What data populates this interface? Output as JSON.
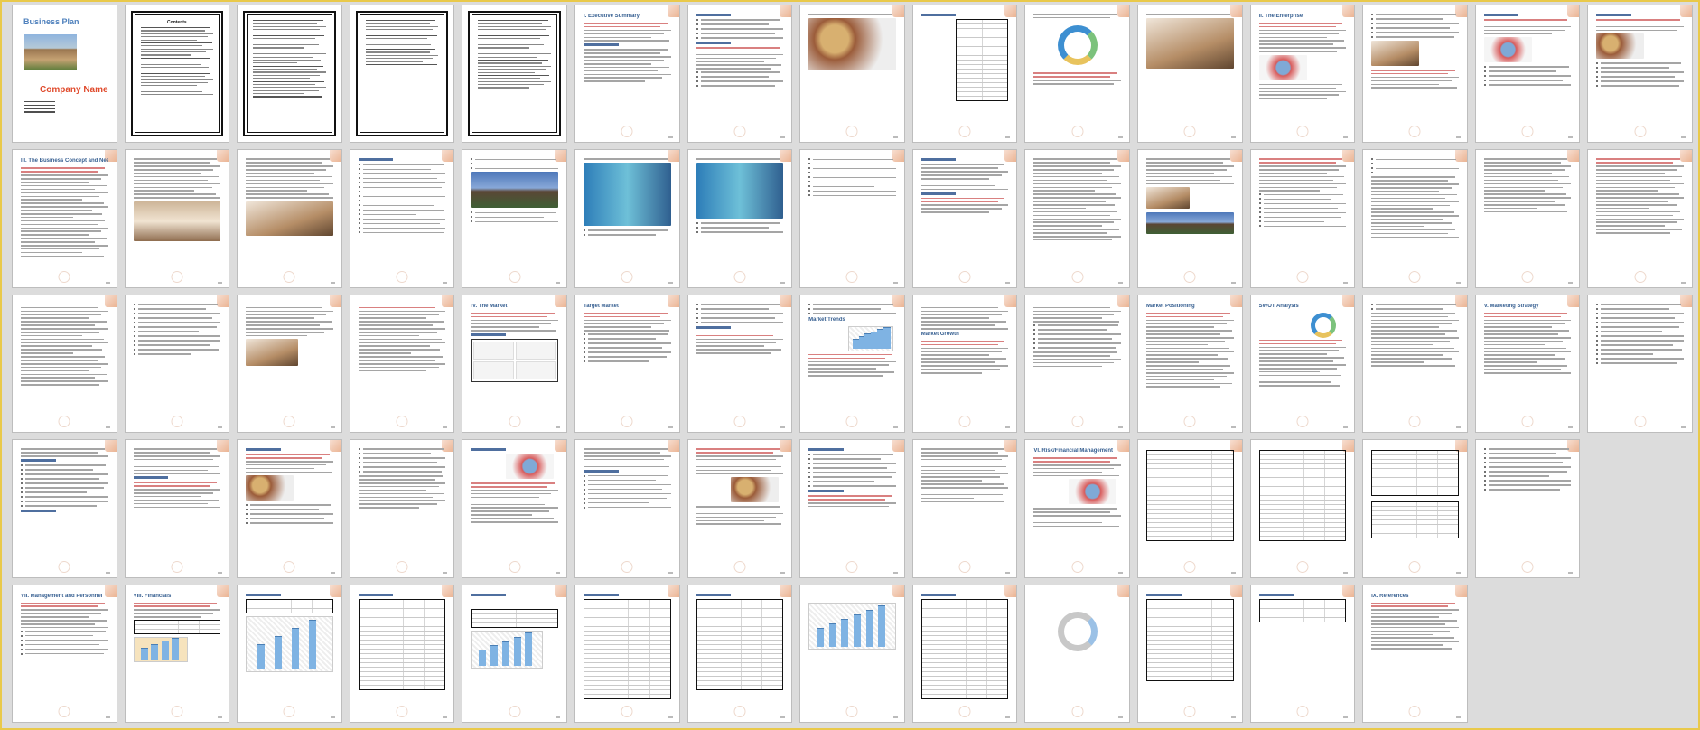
{
  "cover": {
    "title": "Business Plan",
    "company": "Company Name",
    "fields": [
      "",
      "",
      "",
      ""
    ]
  },
  "toc": {
    "title": "Contents"
  },
  "sections": {
    "executive_summary": "I.   Executive Summary",
    "business_concept": "III.  The Business Concept and Need",
    "the_enterprise": "II.   The Enterprise",
    "the_market": "IV.  The Market",
    "target_market": "Target Market",
    "market_trends": "Market Trends",
    "market_growth": "Market Growth",
    "market_positioning": "Market Positioning",
    "swot_analysis": "SWOT Analysis",
    "marketing_strategy": "V.  Marketing Strategy",
    "risk_management": "VI.  Risk/Financial Management",
    "management": "VII.  Management and Personnel",
    "financials": "VIII.  Financials",
    "references": "IX.  References"
  },
  "colors": {
    "frame": "#e9c94a",
    "heading": "#365f91",
    "cover_title": "#4f81bd",
    "cover_company": "#e04b2d",
    "accent_red": "#d98080"
  },
  "icons": [
    "page-corner-decoration-icon",
    "watermark-icon"
  ]
}
